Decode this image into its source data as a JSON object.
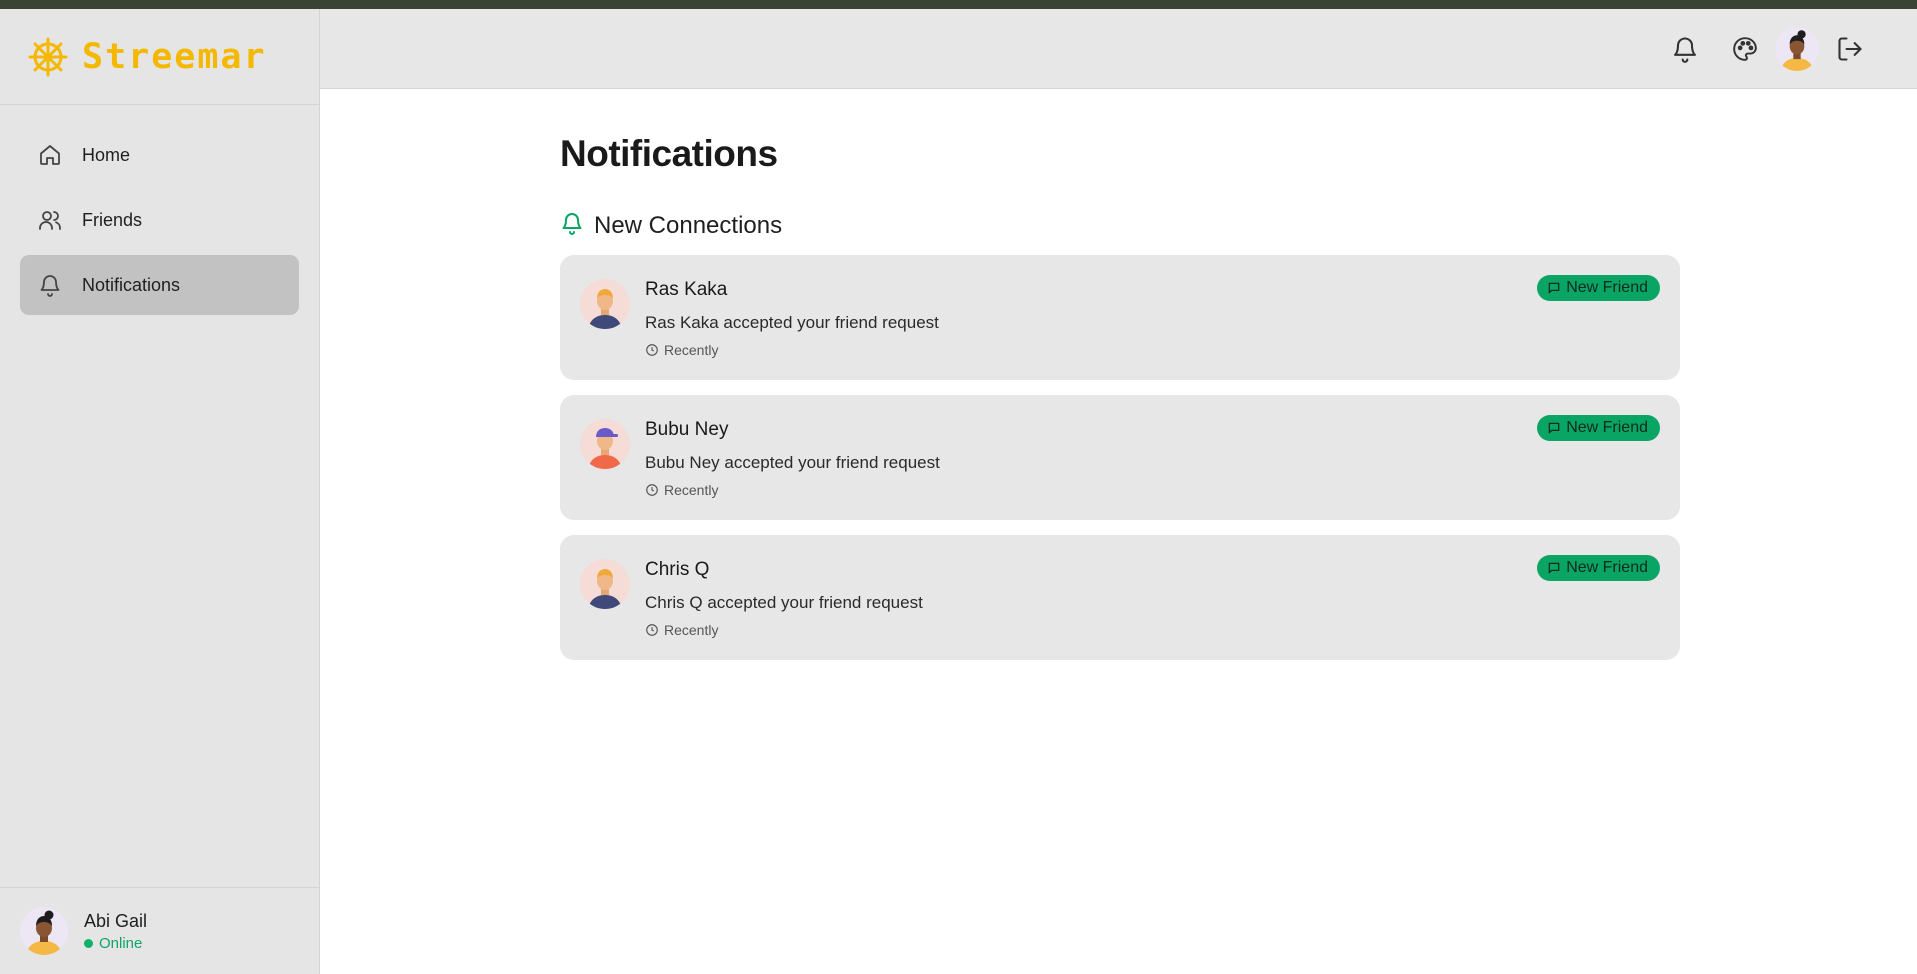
{
  "app": {
    "name": "Streemar",
    "accent": "#f5b800",
    "success": "#0aa565"
  },
  "sidebar": {
    "items": [
      {
        "label": "Home",
        "icon": "home-icon",
        "active": false
      },
      {
        "label": "Friends",
        "icon": "users-icon",
        "active": false
      },
      {
        "label": "Notifications",
        "icon": "bell-icon",
        "active": true
      }
    ],
    "user": {
      "name": "Abi Gail",
      "status": "Online"
    }
  },
  "header": {
    "icons": [
      "bell-icon",
      "palette-icon",
      "avatar",
      "logout-icon"
    ]
  },
  "main": {
    "title": "Notifications",
    "section_title": "New Connections",
    "notifications": [
      {
        "name": "Ras Kaka",
        "message": "Ras Kaka accepted your friend request",
        "time": "Recently",
        "badge": "New Friend"
      },
      {
        "name": "Bubu Ney",
        "message": "Bubu Ney accepted your friend request",
        "time": "Recently",
        "badge": "New Friend"
      },
      {
        "name": "Chris Q",
        "message": "Chris Q accepted your friend request",
        "time": "Recently",
        "badge": "New Friend"
      }
    ]
  }
}
